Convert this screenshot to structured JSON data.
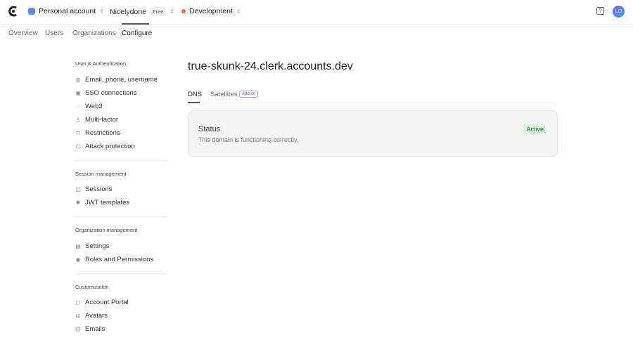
{
  "header": {
    "account": "Personal account",
    "app": "Nicelydone",
    "plan": "Free",
    "instance": "Development",
    "avatar": "LO",
    "help_icon": "?"
  },
  "nav": {
    "tabs": [
      "Overview",
      "Users",
      "Organizations",
      "Configure"
    ],
    "active": "Configure"
  },
  "sidebar": {
    "sections": [
      {
        "title": "User & Authentication",
        "items": [
          "Email, phone, username",
          "SSO connections",
          "Web3",
          "Multi-factor",
          "Restrictions",
          "Attack protection"
        ]
      },
      {
        "title": "Session management",
        "items": [
          "Sessions",
          "JWT templates"
        ]
      },
      {
        "title": "Organization management",
        "items": [
          "Settings",
          "Roles and Permissions"
        ]
      },
      {
        "title": "Customization",
        "items": [
          "Account Portal",
          "Avatars",
          "Emails"
        ]
      }
    ]
  },
  "main": {
    "title": "true-skunk-24.clerk.accounts.dev",
    "tabs": [
      "DNS",
      "Satellites"
    ],
    "addon_badge": "Add-on",
    "status": {
      "heading": "Status",
      "description": "This domain is functioning correctly.",
      "badge": "Active"
    }
  },
  "colors": {
    "accent": "#6c47ff",
    "active_bg": "#d6f5dc",
    "dev_dot": "#f36b3a"
  }
}
